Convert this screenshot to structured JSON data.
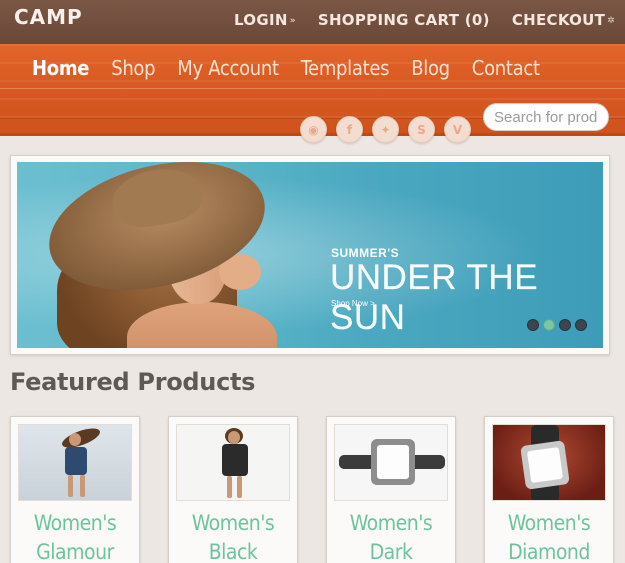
{
  "header": {
    "logo": "CAMP",
    "links": [
      {
        "label": "LOGIN",
        "icon": "login-arrow-icon"
      },
      {
        "label": "SHOPPING CART (0)",
        "icon": ""
      },
      {
        "label": "CHECKOUT",
        "icon": "checkout-arrow-icon"
      }
    ]
  },
  "nav": {
    "items": [
      "Home",
      "Shop",
      "My Account",
      "Templates",
      "Blog",
      "Contact"
    ],
    "active": "Home"
  },
  "search": {
    "placeholder": "Search for products"
  },
  "social": {
    "icons": [
      "rss-icon",
      "facebook-icon",
      "twitter-icon",
      "skype-icon",
      "vimeo-icon"
    ],
    "glyphs": [
      "◉",
      "f",
      "✦",
      "S",
      "V"
    ]
  },
  "banner": {
    "kicker": "SUMMER'S",
    "headline": "UNDER THE SUN",
    "cta": "Shop Now >",
    "slides": 4,
    "active_slide": 2
  },
  "featured": {
    "title": "Featured Products",
    "products": [
      {
        "name": "Women's Glamour"
      },
      {
        "name": "Women's Black"
      },
      {
        "name": "Women's Dark"
      },
      {
        "name": "Women's Diamond"
      }
    ]
  },
  "colors": {
    "topbar": "#6a4838",
    "nav": "#d95a22",
    "accent_green": "#6cc49c",
    "banner_sea": "#5ab5c8"
  }
}
